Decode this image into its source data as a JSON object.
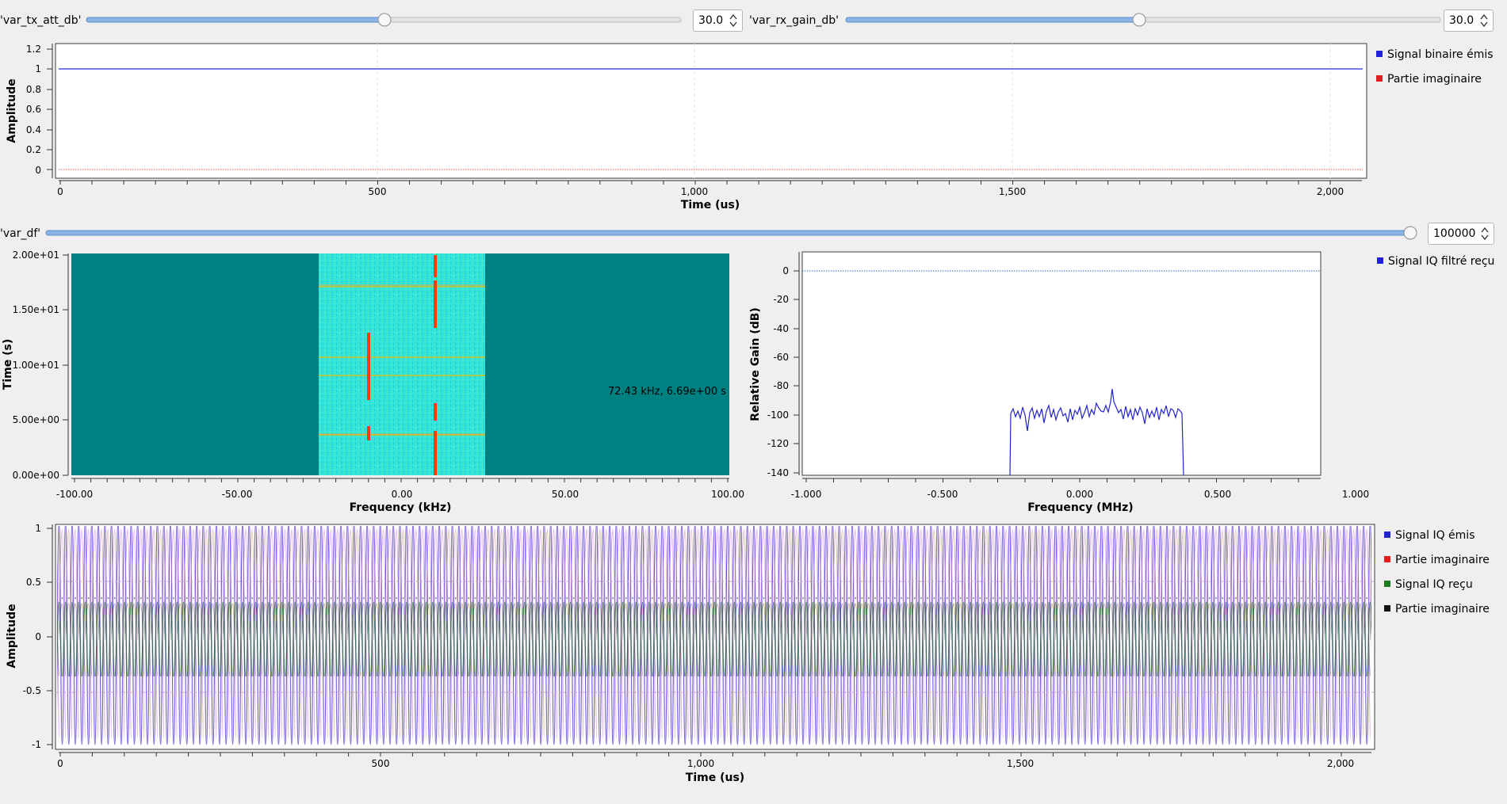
{
  "controls": {
    "tx_att": {
      "label": "'var_tx_att_db'",
      "value": "30.0",
      "fraction": 0.5
    },
    "rx_gain": {
      "label": "'var_rx_gain_db'",
      "value": "30.0",
      "fraction": 0.5
    },
    "df": {
      "label": "'var_df'",
      "value": "100000",
      "fraction": 1.0
    }
  },
  "plot1": {
    "ylabel": "Amplitude",
    "xlabel": "Time (us)",
    "yticks": [
      "1.2",
      "1",
      "0.8",
      "0.6",
      "0.4",
      "0.2",
      "0"
    ],
    "xticks": [
      "0",
      "500",
      "1,000",
      "1,500",
      "2,000"
    ],
    "legend": [
      {
        "label": "Signal binaire émis",
        "color": "#1f22d9"
      },
      {
        "label": "Partie imaginaire",
        "color": "#e02020"
      }
    ]
  },
  "waterfall": {
    "ylabel": "Time (s)",
    "xlabel": "Frequency (kHz)",
    "yticks": [
      "2.00e+01",
      "1.50e+01",
      "1.00e+01",
      "5.00e+00",
      "0.00e+00"
    ],
    "xticks": [
      "-100.00",
      "-50.00",
      "0.00",
      "50.00",
      "100.00"
    ],
    "readout": "72.43 kHz, 6.69e+00 s"
  },
  "freqplot": {
    "ylabel": "Relative Gain (dB)",
    "xlabel": "Frequency (MHz)",
    "yticks": [
      "0",
      "-20",
      "-40",
      "-60",
      "-80",
      "-100",
      "-120",
      "-140"
    ],
    "xticks": [
      "-1.000",
      "-0.500",
      "0.000",
      "0.500",
      "1.000"
    ],
    "legend": [
      {
        "label": "Signal IQ filtré reçu",
        "color": "#1f22d9"
      }
    ]
  },
  "plot3": {
    "ylabel": "Amplitude",
    "xlabel": "Time (us)",
    "yticks": [
      "1",
      "0.5",
      "0",
      "-0.5",
      "-1"
    ],
    "xticks": [
      "0",
      "500",
      "1,000",
      "1,500",
      "2,000"
    ],
    "legend": [
      {
        "label": "Signal IQ émis",
        "color": "#1f22d9"
      },
      {
        "label": "Partie imaginaire",
        "color": "#e02020"
      },
      {
        "label": "Signal IQ reçu",
        "color": "#1d7a1d"
      },
      {
        "label": "Partie imaginaire",
        "color": "#111111"
      }
    ]
  }
}
